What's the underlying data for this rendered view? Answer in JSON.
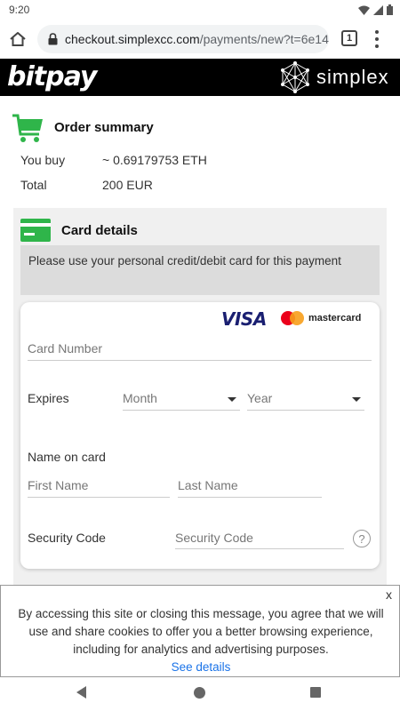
{
  "status_bar": {
    "time": "9:20"
  },
  "browser": {
    "url_host": "checkout.simplexcc.com",
    "url_path": "/payments/new?t=6e14",
    "tab_count": "1"
  },
  "header": {
    "left_logo": "bitpay",
    "right_logo": "simplex"
  },
  "order_summary": {
    "title": "Order summary",
    "you_buy_label": "You buy",
    "you_buy_value": "~ 0.69179753 ETH",
    "total_label": "Total",
    "total_value": "200 EUR"
  },
  "card_details": {
    "title": "Card details",
    "notice": "Please use your personal credit/debit card for this payment",
    "brand_visa": "VISA",
    "brand_mastercard": "mastercard",
    "card_number_placeholder": "Card Number",
    "expires_label": "Expires",
    "month_placeholder": "Month",
    "year_placeholder": "Year",
    "name_on_card_label": "Name on card",
    "first_name_placeholder": "First Name",
    "last_name_placeholder": "Last Name",
    "security_code_label": "Security Code",
    "security_code_placeholder": "Security Code",
    "help_symbol": "?"
  },
  "cookie_banner": {
    "close_symbol": "x",
    "message": "By accessing this site or closing this message, you agree that we will use and share cookies to offer you a better browsing experience, including for analytics and advertising purposes.",
    "link_text": "See details"
  },
  "colors": {
    "header_bg": "#000000",
    "cart_green": "#2fb54a",
    "visa_blue": "#1a1f71",
    "mc_red": "#eb001b",
    "mc_orange": "#f79e1b",
    "link_blue": "#1a73e8"
  }
}
